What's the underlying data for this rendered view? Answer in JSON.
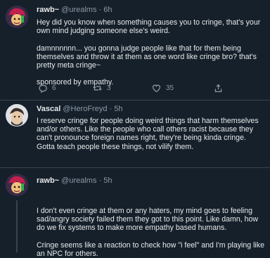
{
  "tweets": [
    {
      "name": "rawb~",
      "handle": "@urealms",
      "sep": "·",
      "time": "6h",
      "text": "Hey did you know when something causes you to cringe, that's your own mind judging someone else's weird.\n\ndamnnnnnn... you gonna judge people like that for them being themselves and throw it at them as one word like cringe bro? that's pretty meta cringe~\n\nsponsored by empathy.",
      "replies": "6",
      "retweets": "3",
      "likes": "35"
    },
    {
      "name": "Vascal",
      "handle": "@HeroFreyd",
      "sep": "·",
      "time": "5h",
      "text": "I reserve cringe for people doing weird things that harm themselves and/or others. Like the people who call others racist because they can't pronounce foreign names right, they're being kinda cringe. Gotta teach people these things, not vilify them."
    },
    {
      "name": "rawb~",
      "handle": "@urealms",
      "sep": "·",
      "time": "5h",
      "text": "I don't even cringe at them or any haters, my mind goes to feeling sad/angry society failed them they got to this point. Like damn, how do we fix systems to make more empathy based humans.\n\nCringe seems like a reaction to check how \"i feel\" and I'm playing like an NPC for others."
    }
  ],
  "icons": {
    "reply": "reply-icon",
    "retweet": "retweet-icon",
    "like": "heart-icon",
    "share": "share-icon"
  },
  "colors": {
    "background": "#15202b",
    "divider": "#38444d",
    "secondary_text": "#8b98a5"
  }
}
